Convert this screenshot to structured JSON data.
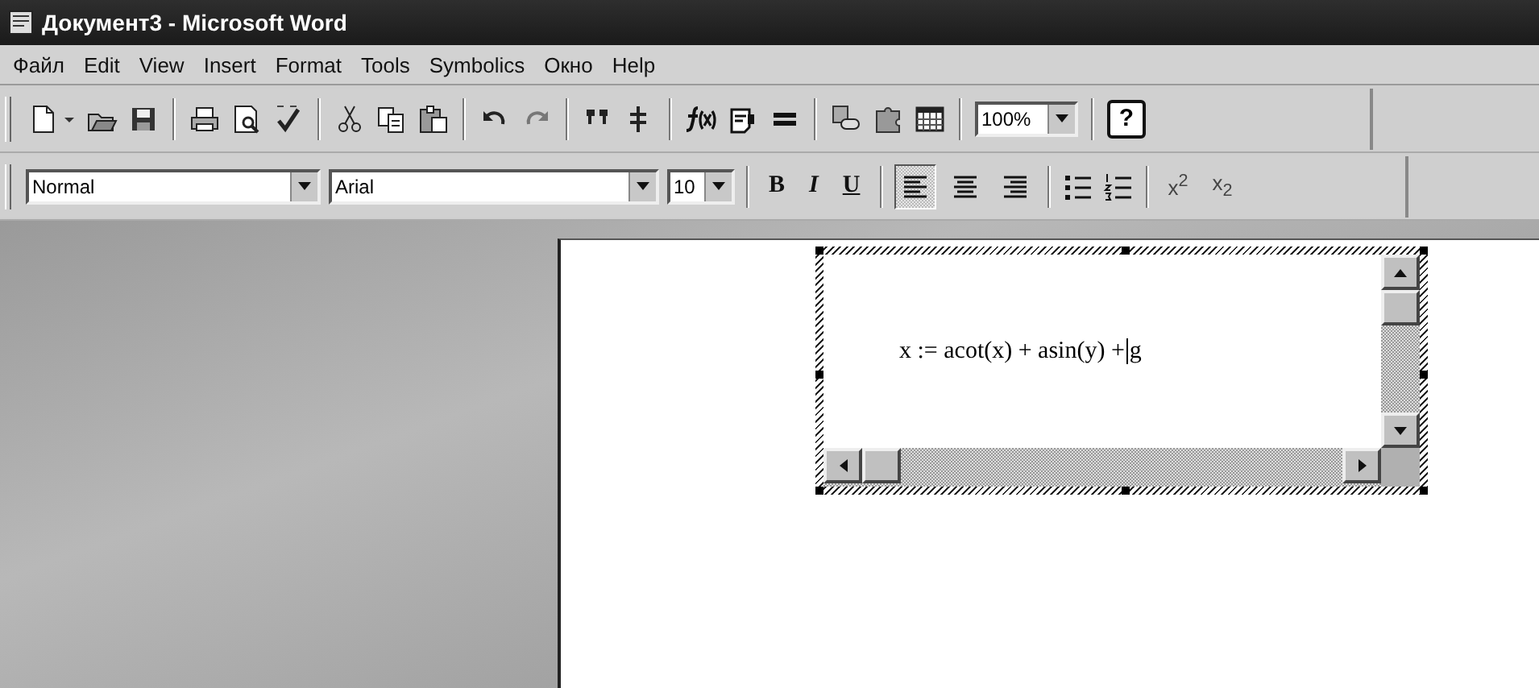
{
  "window": {
    "title": "Документ3 - Microsoft Word"
  },
  "menu": [
    {
      "label": "Файл"
    },
    {
      "label": "Edit"
    },
    {
      "label": "View"
    },
    {
      "label": "Insert"
    },
    {
      "label": "Format"
    },
    {
      "label": "Tools"
    },
    {
      "label": "Symbolics"
    },
    {
      "label": "Окно"
    },
    {
      "label": "Help"
    }
  ],
  "standard_toolbar": [
    {
      "kind": "new"
    },
    {
      "kind": "dropdown"
    },
    {
      "kind": "open"
    },
    {
      "kind": "save"
    },
    {
      "kind": "separator"
    },
    {
      "kind": "print"
    },
    {
      "kind": "preview"
    },
    {
      "kind": "spelling"
    },
    {
      "kind": "separator"
    },
    {
      "kind": "cut"
    },
    {
      "kind": "copy"
    },
    {
      "kind": "paste"
    },
    {
      "kind": "separator"
    },
    {
      "kind": "undo"
    },
    {
      "kind": "redo"
    },
    {
      "kind": "separator"
    },
    {
      "kind": "columns"
    },
    {
      "kind": "split"
    },
    {
      "kind": "separator"
    },
    {
      "kind": "function"
    },
    {
      "kind": "doc"
    },
    {
      "kind": "equals"
    },
    {
      "kind": "separator"
    },
    {
      "kind": "link"
    },
    {
      "kind": "puzzle"
    },
    {
      "kind": "table"
    },
    {
      "kind": "separator"
    },
    {
      "kind": "zoom",
      "value": "100%"
    },
    {
      "kind": "separator"
    },
    {
      "kind": "help",
      "label": "?"
    }
  ],
  "formatting_toolbar": {
    "style": "Normal",
    "font": "Arial",
    "size": "10",
    "bold": "B",
    "italic": "I",
    "underline": "U",
    "alignment": [
      {
        "kind": "left",
        "selected": true
      },
      {
        "kind": "center",
        "selected": false
      },
      {
        "kind": "right",
        "selected": false
      }
    ],
    "superscript": "x$^{2}$",
    "subscript": "x$_{2}$"
  },
  "math_object": {
    "expression_before_cursor": "x := acot(x) + asin(y) +",
    "expression_after_cursor": "g"
  }
}
